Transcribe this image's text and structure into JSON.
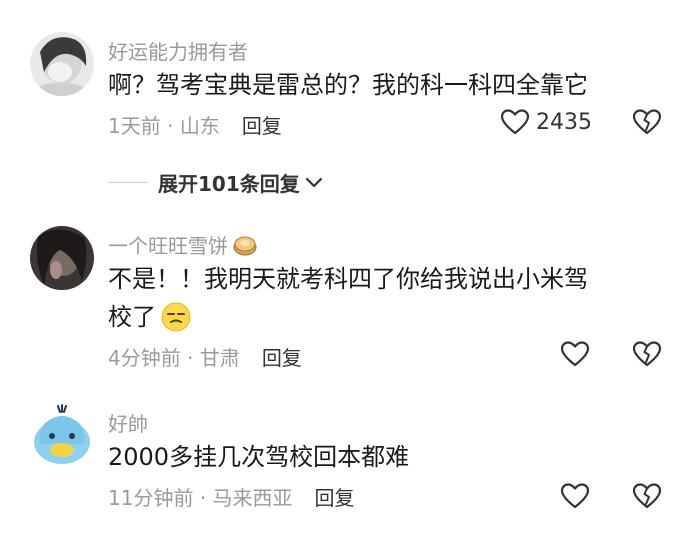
{
  "comments": [
    {
      "username": "好运能力拥有者",
      "text": "啊？驾考宝典是雷总的？我的科一科四全靠它",
      "time": "1天前",
      "location": "山东",
      "reply_label": "回复",
      "likes": "2435"
    },
    {
      "username": "一个旺旺雪饼",
      "text_line1": "不是！！我明天就考科四了你给我说出小米驾",
      "text_line2": "校了",
      "time": "4分钟前",
      "location": "甘肃",
      "reply_label": "回复"
    },
    {
      "username": "好帥",
      "text": "2000多挂几次驾校回本都难",
      "time": "11分钟前",
      "location": "马来西亚",
      "reply_label": "回复"
    }
  ],
  "expand": {
    "label": "展开101条回复"
  },
  "icons": {
    "like": "heart-outline-icon",
    "dislike": "broken-heart-icon",
    "expand": "chevron-down-icon"
  },
  "colors": {
    "text": "#1a1a1a",
    "muted": "#9a9a9a",
    "reply": "#333333"
  }
}
